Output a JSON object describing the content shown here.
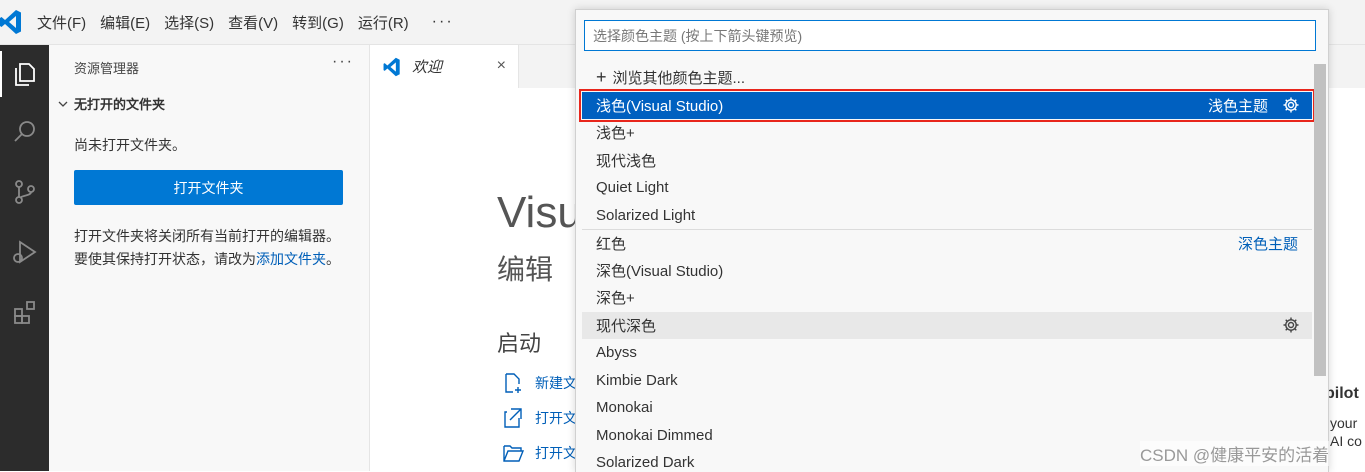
{
  "app": {
    "logo_icon": "vscode-logo-icon",
    "accent": "#0078d4"
  },
  "menu": {
    "items": [
      "文件(F)",
      "编辑(E)",
      "选择(S)",
      "查看(V)",
      "转到(G)",
      "运行(R)"
    ],
    "more": "···"
  },
  "activity_bar": {
    "items": [
      "explorer-icon",
      "search-icon",
      "source-control-icon",
      "run-debug-icon",
      "extensions-icon"
    ]
  },
  "sidebar": {
    "title": "资源管理器",
    "more": "···",
    "folder_label": "无打开的文件夹",
    "no_folder_text": "尚未打开文件夹。",
    "open_button": "打开文件夹",
    "desc": "打开文件夹将关闭所有当前打开的编辑器。要使其保持打开状态，请改为",
    "desc_link": "添加文件夹",
    "desc_end": "。"
  },
  "tab": {
    "label": "欢迎",
    "close": "×"
  },
  "welcome": {
    "title": "Visu",
    "subtitle": "编辑",
    "start_heading": "启动",
    "start_items": [
      "新建文",
      "打开文",
      "打开文"
    ],
    "copilot_title": "pilot",
    "copilot_line1": "your",
    "copilot_line2": "AI co"
  },
  "quick_pick": {
    "placeholder": "选择颜色主题 (按上下箭头键预览)",
    "browse_label": "浏览其他颜色主题...",
    "light_group_label": "浅色主题",
    "dark_group_label": "深色主题",
    "items": [
      "浅色(Visual Studio)",
      "浅色+",
      "现代浅色",
      "Quiet Light",
      "Solarized Light",
      "红色",
      "深色(Visual Studio)",
      "深色+",
      "现代深色",
      "Abyss",
      "Kimbie Dark",
      "Monokai",
      "Monokai Dimmed",
      "Solarized Dark"
    ],
    "selected_index": 0,
    "selection_color": "#0060c0",
    "highlight_border_color": "#e8261c"
  },
  "watermark": "CSDN @健康平安的活着"
}
